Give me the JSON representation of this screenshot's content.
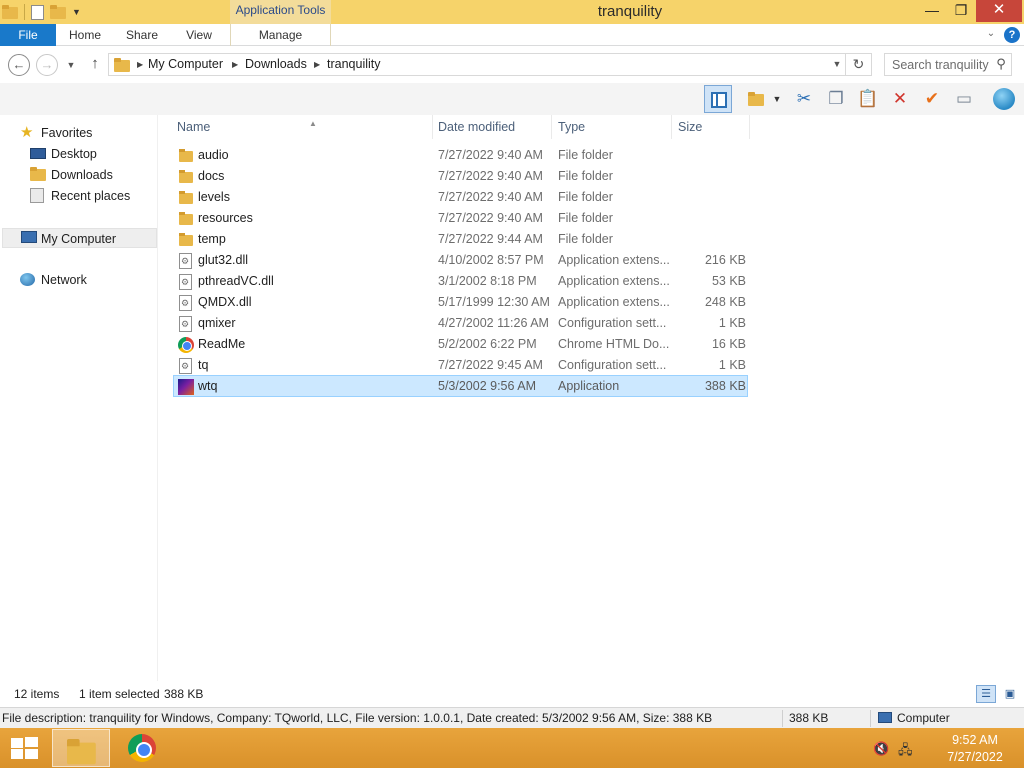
{
  "window": {
    "title": "tranquility",
    "context_tab_title": "Application Tools",
    "minimize_glyph": "—",
    "maximize_glyph": "❐",
    "close_glyph": "✕"
  },
  "ribbon": {
    "tabs": {
      "file": "File",
      "home": "Home",
      "share": "Share",
      "view": "View",
      "manage": "Manage"
    },
    "help_glyph": "?"
  },
  "address": {
    "crumbs": [
      "My Computer",
      "Downloads",
      "tranquility"
    ],
    "separator_glyph": "▶",
    "search_placeholder": "Search tranquility"
  },
  "toolbar": {
    "icons": [
      "preview-pane-icon",
      "new-folder-icon",
      "dropdown-arrow-icon",
      "cut-icon",
      "copy-icon",
      "paste-icon",
      "delete-icon",
      "check-icon",
      "rename-icon",
      "globe-icon"
    ]
  },
  "nav": {
    "favorites": "Favorites",
    "desktop": "Desktop",
    "downloads": "Downloads",
    "recent_places": "Recent places",
    "my_computer": "My Computer",
    "network": "Network"
  },
  "columns": {
    "name": "Name",
    "date_modified": "Date modified",
    "type": "Type",
    "size": "Size"
  },
  "files": [
    {
      "name": "audio",
      "date": "7/27/2022 9:40 AM",
      "type": "File folder",
      "size": "",
      "icon": "folder"
    },
    {
      "name": "docs",
      "date": "7/27/2022 9:40 AM",
      "type": "File folder",
      "size": "",
      "icon": "folder"
    },
    {
      "name": "levels",
      "date": "7/27/2022 9:40 AM",
      "type": "File folder",
      "size": "",
      "icon": "folder"
    },
    {
      "name": "resources",
      "date": "7/27/2022 9:40 AM",
      "type": "File folder",
      "size": "",
      "icon": "folder"
    },
    {
      "name": "temp",
      "date": "7/27/2022 9:44 AM",
      "type": "File folder",
      "size": "",
      "icon": "folder"
    },
    {
      "name": "glut32.dll",
      "date": "4/10/2002 8:57 PM",
      "type": "Application extens...",
      "size": "216 KB",
      "icon": "dll"
    },
    {
      "name": "pthreadVC.dll",
      "date": "3/1/2002 8:18 PM",
      "type": "Application extens...",
      "size": "53 KB",
      "icon": "dll"
    },
    {
      "name": "QMDX.dll",
      "date": "5/17/1999 12:30 AM",
      "type": "Application extens...",
      "size": "248 KB",
      "icon": "dll"
    },
    {
      "name": "qmixer",
      "date": "4/27/2002 11:26 AM",
      "type": "Configuration sett...",
      "size": "1 KB",
      "icon": "config"
    },
    {
      "name": "ReadMe",
      "date": "5/2/2002 6:22 PM",
      "type": "Chrome HTML Do...",
      "size": "16 KB",
      "icon": "chrome"
    },
    {
      "name": "tq",
      "date": "7/27/2022 9:45 AM",
      "type": "Configuration sett...",
      "size": "1 KB",
      "icon": "config"
    },
    {
      "name": "wtq",
      "date": "5/3/2002 9:56 AM",
      "type": "Application",
      "size": "388 KB",
      "icon": "app",
      "selected": true
    }
  ],
  "status": {
    "item_count": "12 items",
    "selection": "1 item selected",
    "selection_size": "388 KB"
  },
  "infobar": {
    "description": "File description: tranquility for Windows, Company: TQworld, LLC, File version: 1.0.0.1, Date created: 5/3/2002 9:56 AM, Size: 388 KB",
    "size": "388 KB",
    "location": "Computer"
  },
  "taskbar": {
    "time": "9:52 AM",
    "date": "7/27/2022"
  },
  "colors": {
    "accent_file_tab": "#1979ca",
    "titlebar": "#f6d36a",
    "selection": "#cce8ff",
    "taskbar": "#e8a43c"
  }
}
